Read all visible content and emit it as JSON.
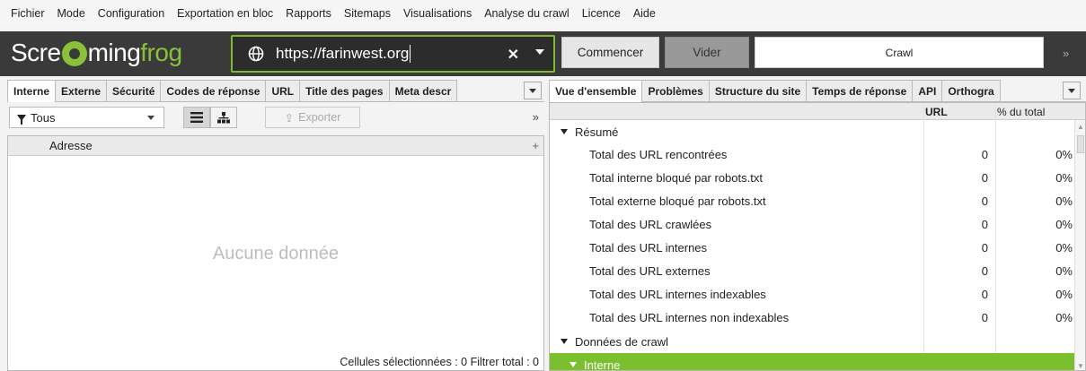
{
  "menu": [
    "Fichier",
    "Mode",
    "Configuration",
    "Exportation en bloc",
    "Rapports",
    "Sitemaps",
    "Visualisations",
    "Analyse du crawl",
    "Licence",
    "Aide"
  ],
  "logo": {
    "part1": "Scre",
    "part2": "ming",
    "part3": "frog"
  },
  "url_input": {
    "value": "https://farinwest.org"
  },
  "toolbar": {
    "start_label": "Commencer",
    "clear_label": "Vider",
    "mode_label": "Crawl",
    "more": "»"
  },
  "left": {
    "tabs": [
      "Interne",
      "Externe",
      "Sécurité",
      "Codes de réponse",
      "URL",
      "Title des pages",
      "Meta descr"
    ],
    "filter": "Tous",
    "export_label": "Exporter",
    "more": "»",
    "column_header": "Adresse",
    "add_column": "+",
    "empty_message": "Aucune donnée",
    "status": "Cellules sélectionnées : 0  Filtrer total : 0"
  },
  "right": {
    "tabs": [
      "Vue d'ensemble",
      "Problèmes",
      "Structure du site",
      "Temps de réponse",
      "API",
      "Orthogra"
    ],
    "columns": {
      "url": "URL",
      "pct": "% du total"
    },
    "section1": "Résumé",
    "rows": [
      {
        "label": "Total des URL rencontrées",
        "url": "0",
        "pct": "0%"
      },
      {
        "label": "Total interne bloqué par robots.txt",
        "url": "0",
        "pct": "0%"
      },
      {
        "label": "Total externe bloqué par robots.txt",
        "url": "0",
        "pct": "0%"
      },
      {
        "label": "Total des URL crawlées",
        "url": "0",
        "pct": "0%"
      },
      {
        "label": "Total des URL internes",
        "url": "0",
        "pct": "0%"
      },
      {
        "label": "Total des URL externes",
        "url": "0",
        "pct": "0%"
      },
      {
        "label": "Total des URL internes indexables",
        "url": "0",
        "pct": "0%"
      },
      {
        "label": "Total des URL internes non indexables",
        "url": "0",
        "pct": "0%"
      }
    ],
    "section2": "Données de crawl",
    "section3": "Interne"
  },
  "colors": {
    "accent": "#7cbf2e",
    "toolbar_bg": "#3a3a3a"
  }
}
